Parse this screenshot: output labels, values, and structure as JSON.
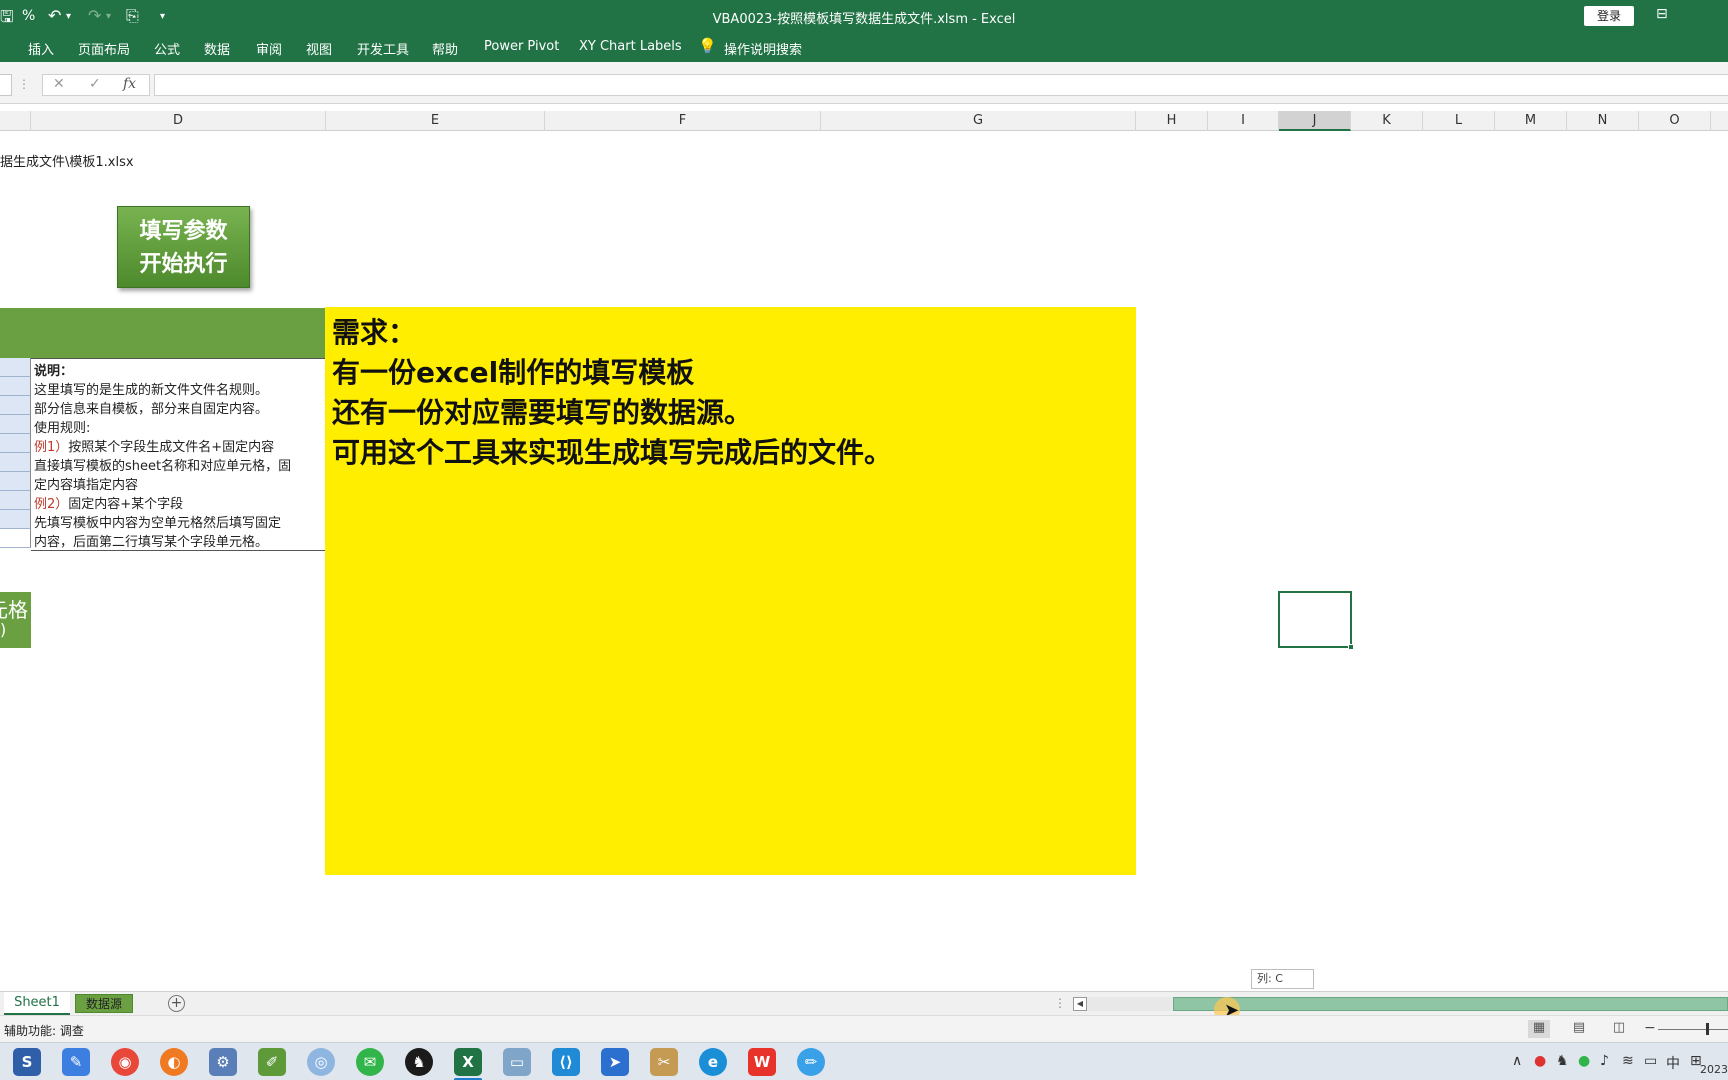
{
  "titlebar": {
    "title": "VBA0023-按照模板填写数据生成文件.xlsm  -  Excel",
    "login_label": "登录",
    "quick_access": {
      "save_icon": "save-icon",
      "percent_label": "%",
      "undo_icon": "undo-icon",
      "redo_icon": "redo-icon",
      "paste_icon": "paste-icon",
      "customize_icon": "chevron-down-icon"
    }
  },
  "menu": {
    "items": [
      "插入",
      "页面布局",
      "公式",
      "数据",
      "审阅",
      "视图",
      "开发工具",
      "帮助",
      "Power Pivot",
      "XY Chart Labels",
      "操作说明搜索"
    ]
  },
  "formula_bar": {
    "cancel_glyph": "✕",
    "confirm_glyph": "✓",
    "fx_label": "fx",
    "value": ""
  },
  "columns": {
    "headers": [
      "D",
      "E",
      "F",
      "G",
      "H",
      "I",
      "J",
      "K",
      "L",
      "M",
      "N",
      "O"
    ],
    "selected": "J"
  },
  "sheet": {
    "path_text": "据生成文件\\模板1.xlsx",
    "run_button": {
      "line1": "填写参数",
      "line2": "开始执行"
    },
    "note": {
      "title": "说明：",
      "line1": "这里填写的是生成的新文件文件名规则。",
      "line2": "部分信息来自模板，部分来自固定内容。",
      "line3": "使用规则:",
      "ex1_label": "例1）",
      "ex1_text": "按照某个字段生成文件名+固定内容",
      "line5": "直接填写模板的sheet名称和对应单元格，固",
      "line6": "定内容填指定内容",
      "ex2_label": "例2）",
      "ex2_text": "固定内容+某个字段",
      "line8": "先填写模板中内容为空单元格然后填写固定",
      "line9": "内容，后面第二行填写某个字段单元格。"
    },
    "cut_cell": {
      "line1": "元格",
      "line2": ")"
    },
    "yellow": {
      "line1": "需求：",
      "line2": "有一份excel制作的填写模板",
      "line3": "还有一份对应需要填写的数据源。",
      "line4": "可用这个工具来实现生成填写完成后的文件。"
    }
  },
  "tooltip": {
    "text": "列: C"
  },
  "tabs": {
    "sheet1": "Sheet1",
    "data": "数据源",
    "add_glyph": "+"
  },
  "status": {
    "text": "辅助功能: 调查"
  },
  "taskbar": {
    "tray": {
      "ime": "中",
      "year": "2023"
    }
  },
  "colors": {
    "excel_green": "#217346",
    "header_green": "#6aa042",
    "highlight_yellow": "#ffee00"
  }
}
